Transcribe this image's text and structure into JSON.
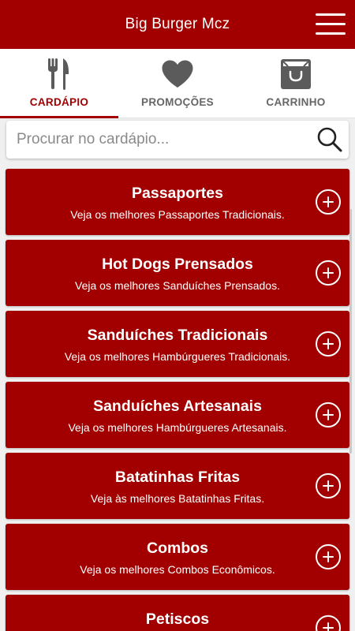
{
  "header": {
    "title": "Big Burger Mcz",
    "menu_icon": "hamburger-menu-icon"
  },
  "tabs": [
    {
      "label": "CARDÁPIO",
      "icon": "fork-knife-icon",
      "active": true
    },
    {
      "label": "PROMOÇÕES",
      "icon": "heart-icon",
      "active": false
    },
    {
      "label": "CARRINHO",
      "icon": "shopping-bag-icon",
      "active": false
    }
  ],
  "search": {
    "placeholder": "Procurar no cardápio...",
    "value": "",
    "icon": "search-icon"
  },
  "categories": [
    {
      "title": "Passaportes",
      "subtitle": "Veja os melhores Passaportes Tradicionais."
    },
    {
      "title": "Hot Dogs Prensados",
      "subtitle": "Veja os melhores Sanduíches Prensados."
    },
    {
      "title": "Sanduíches Tradicionais",
      "subtitle": "Veja os melhores Hambúrgueres Tradicionais."
    },
    {
      "title": "Sanduíches Artesanais",
      "subtitle": "Veja os melhores Hambúrgueres Artesanais."
    },
    {
      "title": "Batatinhas Fritas",
      "subtitle": "Veja às melhores Batatinhas Fritas."
    },
    {
      "title": "Combos",
      "subtitle": "Veja os melhores Combos Econômicos."
    },
    {
      "title": "Petiscos",
      "subtitle": ""
    }
  ],
  "colors": {
    "brand": "#a20000",
    "tab_inactive": "#666666",
    "icon_gray": "#555555",
    "background": "#f0f0f0"
  }
}
